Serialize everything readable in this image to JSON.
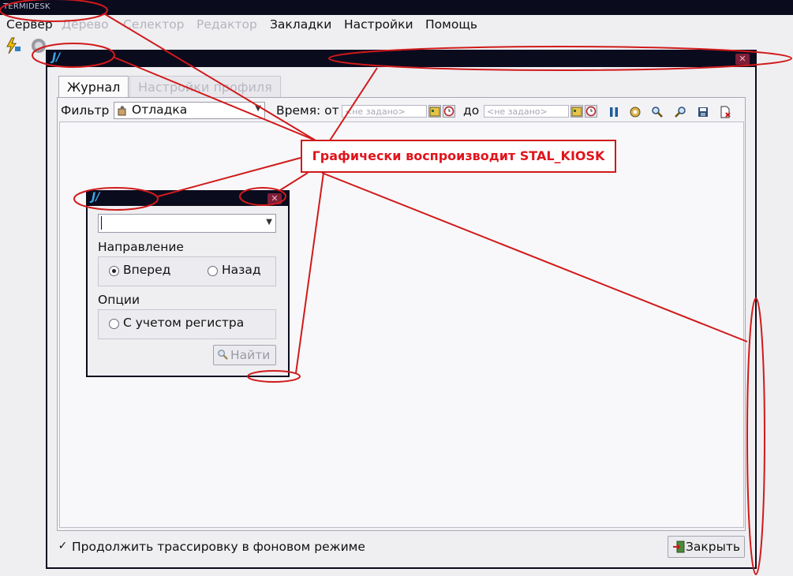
{
  "app": {
    "title": "TERMIDESK"
  },
  "menu": [
    {
      "label": "Сервер",
      "enabled": true
    },
    {
      "label": "Дерево",
      "enabled": false
    },
    {
      "label": "Селектор",
      "enabled": false
    },
    {
      "label": "Редактор",
      "enabled": false
    },
    {
      "label": "Закладки",
      "enabled": true
    },
    {
      "label": "Настройки",
      "enabled": true
    },
    {
      "label": "Помощь",
      "enabled": true
    }
  ],
  "toolbar": {
    "icons": [
      "connect-icon",
      "disconnect-icon"
    ]
  },
  "main_window": {
    "close_symbol": "✕",
    "tabs": [
      {
        "label": "Журнал",
        "active": true
      },
      {
        "label": "Настройки профиля",
        "active": false
      }
    ],
    "filter": {
      "label": "Фильтр",
      "value": "Отладка"
    },
    "time": {
      "label_from": "Время: от",
      "from_placeholder": "<не задано>",
      "label_to": "до",
      "to_placeholder": "<не задано>"
    },
    "toolbar_icons": [
      "pause-icon",
      "settings-icon",
      "search-icon",
      "find-next-icon",
      "save-icon",
      "clear-icon"
    ],
    "continue_trace": {
      "label": "Продолжить трассировку в фоновом режиме",
      "checked": true
    },
    "close_button": "Закрыть"
  },
  "find_dialog": {
    "close_symbol": "✕",
    "search_value": "",
    "direction_label": "Направление",
    "forward_label": "Вперед",
    "backward_label": "Назад",
    "direction_selected": "forward",
    "options_label": "Опции",
    "case_sensitive_label": "С учетом регистра",
    "find_button": "Найти"
  },
  "annotation": {
    "text": "Графически воспроизводит STAL_KIOSK",
    "color": "#e1141c"
  }
}
